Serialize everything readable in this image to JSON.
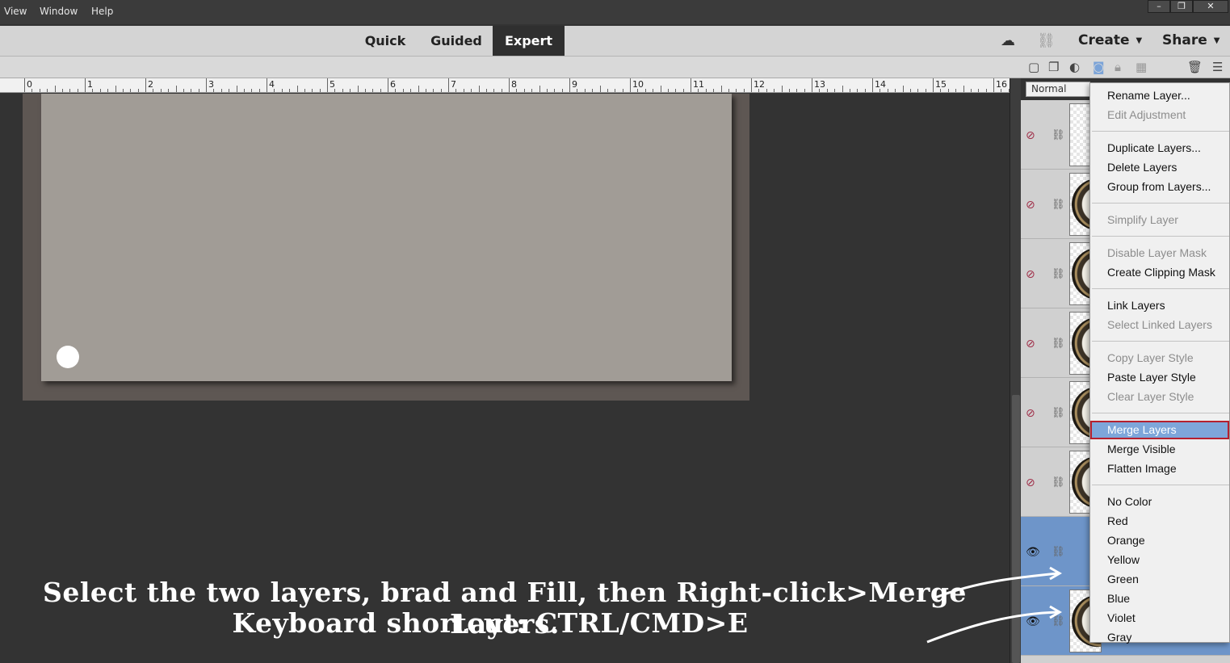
{
  "menubar": {
    "items": [
      "View",
      "Window",
      "Help"
    ],
    "window_controls": [
      "–",
      "❐",
      "✕"
    ]
  },
  "modebar": {
    "tabs": [
      {
        "label": "Quick",
        "active": false
      },
      {
        "label": "Guided",
        "active": false
      },
      {
        "label": "Expert",
        "active": true
      }
    ],
    "create_label": "Create",
    "share_label": "Share",
    "icons": [
      "cloud-icon",
      "link-icon"
    ]
  },
  "ruler": {
    "labels": [
      "0",
      "1",
      "2",
      "3",
      "4",
      "5",
      "6",
      "7",
      "8",
      "9",
      "10",
      "11",
      "12",
      "13",
      "14",
      "15",
      "16"
    ]
  },
  "layers": {
    "blend_mode": "Normal",
    "rows": [
      {
        "visible": false,
        "selected": false,
        "thumb": "transparent"
      },
      {
        "visible": false,
        "selected": false,
        "thumb": "brad"
      },
      {
        "visible": false,
        "selected": false,
        "thumb": "brad"
      },
      {
        "visible": false,
        "selected": false,
        "thumb": "brad"
      },
      {
        "visible": false,
        "selected": false,
        "thumb": "brad"
      },
      {
        "visible": false,
        "selected": false,
        "thumb": "brad"
      },
      {
        "visible": true,
        "selected": true,
        "thumb": "fill"
      },
      {
        "visible": true,
        "selected": true,
        "thumb": "brad"
      }
    ]
  },
  "context_menu": {
    "groups": [
      [
        {
          "label": "Rename Layer...",
          "enabled": true
        },
        {
          "label": "Edit Adjustment",
          "enabled": false
        }
      ],
      [
        {
          "label": "Duplicate Layers...",
          "enabled": true
        },
        {
          "label": "Delete Layers",
          "enabled": true
        },
        {
          "label": "Group from Layers...",
          "enabled": true
        }
      ],
      [
        {
          "label": "Simplify Layer",
          "enabled": false
        }
      ],
      [
        {
          "label": "Disable Layer Mask",
          "enabled": false
        },
        {
          "label": "Create Clipping Mask",
          "enabled": true
        }
      ],
      [
        {
          "label": "Link Layers",
          "enabled": true
        },
        {
          "label": "Select Linked Layers",
          "enabled": false
        }
      ],
      [
        {
          "label": "Copy Layer Style",
          "enabled": false
        },
        {
          "label": "Paste Layer Style",
          "enabled": true
        },
        {
          "label": "Clear Layer Style",
          "enabled": false
        }
      ],
      [
        {
          "label": "Merge Layers",
          "enabled": true,
          "highlighted": true
        },
        {
          "label": "Merge Visible",
          "enabled": true
        },
        {
          "label": "Flatten Image",
          "enabled": true
        }
      ],
      [
        {
          "label": "No Color",
          "enabled": true
        },
        {
          "label": "Red",
          "enabled": true
        },
        {
          "label": "Orange",
          "enabled": true
        },
        {
          "label": "Yellow",
          "enabled": true
        },
        {
          "label": "Green",
          "enabled": true
        },
        {
          "label": "Blue",
          "enabled": true
        },
        {
          "label": "Violet",
          "enabled": true
        },
        {
          "label": "Gray",
          "enabled": true
        }
      ]
    ]
  },
  "caption": {
    "line1": "Select the two layers, brad and Fill, then Right-click>Merge Layers.",
    "line2": "Keyboard shortcut: CTRL/CMD>E"
  },
  "colors": {
    "canvas_card": "#a19c96",
    "canvas_bg": "#5e5753",
    "workspace": "#333333",
    "selection_blue": "#6e95c9",
    "menu_highlight": "#7ea6da",
    "highlight_border": "#b5202f"
  }
}
